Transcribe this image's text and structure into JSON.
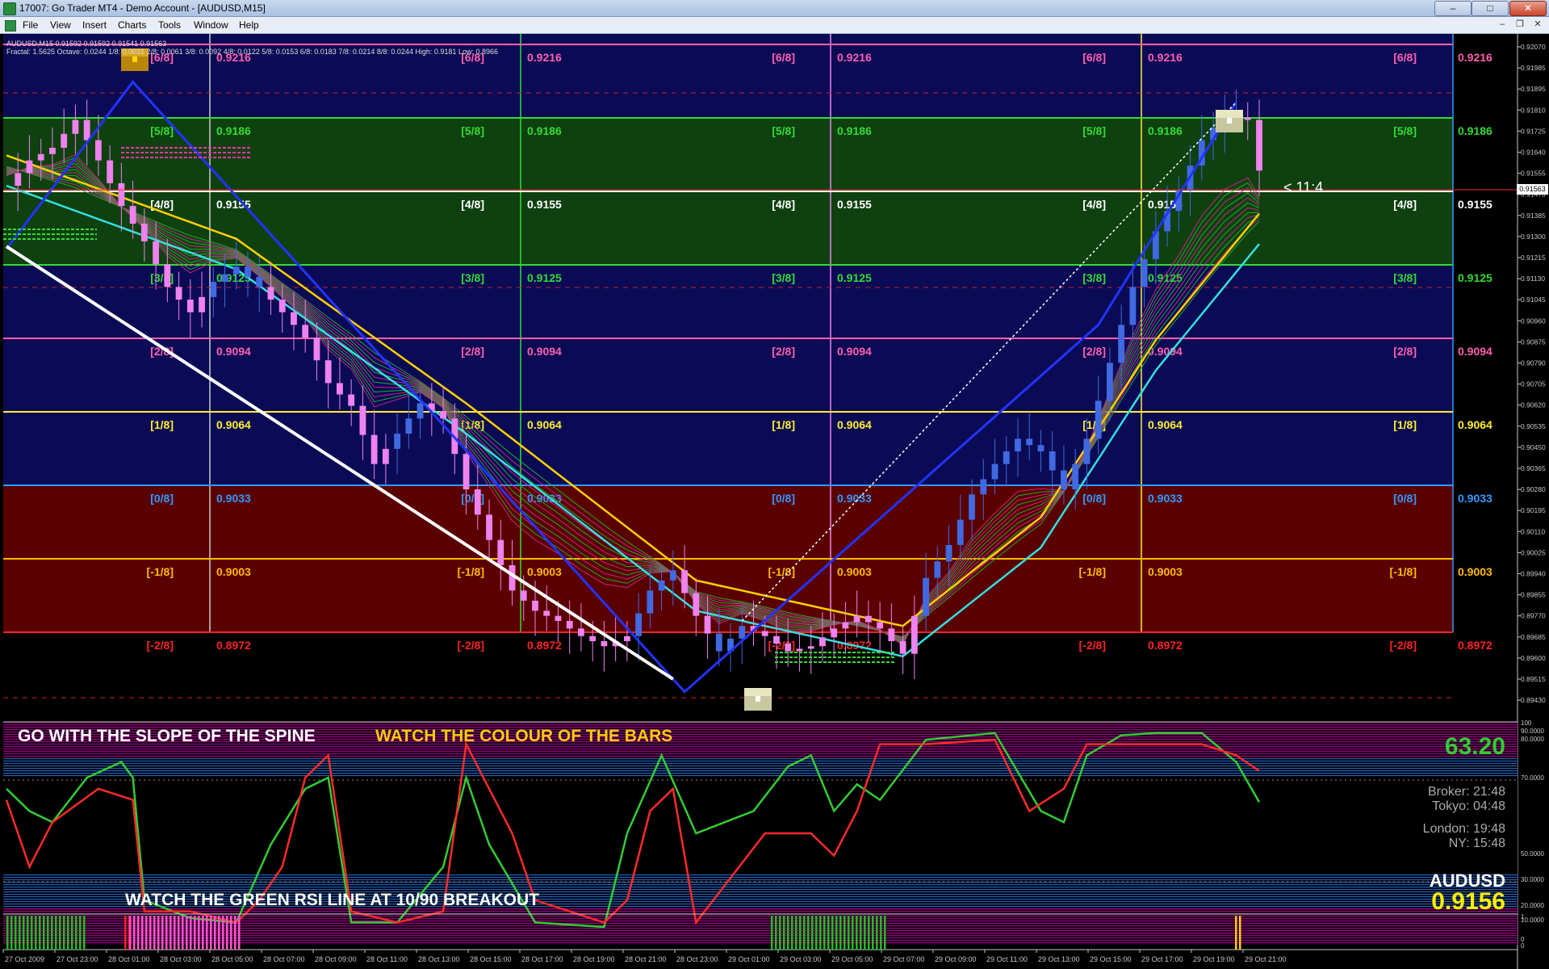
{
  "window": {
    "title": "17007: Go Trader MT4 - Demo Account - [AUDUSD,M15]",
    "min_label": "–",
    "max_label": "□",
    "close_label": "✕",
    "mdi_min": "–",
    "mdi_restore": "❐",
    "mdi_close": "✕"
  },
  "menu": [
    "File",
    "View",
    "Insert",
    "Charts",
    "Tools",
    "Window",
    "Help"
  ],
  "chart_header": {
    "symbol_line": "AUDUSD,M15  0.91592 0.91592 0.91541 0.91563",
    "fractal_line": "Fractal: 1.5625    Octave: 0.0244    1/8: 0.0031  2/8: 0.0061  3/8: 0.0092  4/8: 0.0122  5/8: 0.0153  6/8: 0.0183  7/8: 0.0214  8/8: 0.0244  High: 0.9181  Low: 0.8966"
  },
  "colors": {
    "bull": "#4169e1",
    "bear": "#ee82ee",
    "zone_top": "#0b0b55",
    "zone_green": "#0f4010",
    "zone_red": "#5a0000"
  },
  "murrey": [
    {
      "label": "[6/8]",
      "price": "0.9216",
      "color": "#ff5fb0"
    },
    {
      "label": "[5/8]",
      "price": "0.9186",
      "color": "#33dd33"
    },
    {
      "label": "[4/8]",
      "price": "0.9155",
      "color": "#ffffff"
    },
    {
      "label": "[3/8]",
      "price": "0.9125",
      "color": "#33dd33"
    },
    {
      "label": "[2/8]",
      "price": "0.9094",
      "color": "#ff5fb0"
    },
    {
      "label": "[1/8]",
      "price": "0.9064",
      "color": "#ffee33"
    },
    {
      "label": "[0/8]",
      "price": "0.9033",
      "color": "#3399ff"
    },
    {
      "label": "[-1/8]",
      "price": "0.9003",
      "color": "#ffbb00"
    },
    {
      "label": "[-2/8]",
      "price": "0.8972",
      "color": "#ff2222"
    }
  ],
  "price_axis": [
    "0.92070",
    "0.91985",
    "0.91895",
    "0.91810",
    "0.91725",
    "0.91640",
    "0.91555",
    "0.91470",
    "0.91385",
    "0.91300",
    "0.91215",
    "0.91130",
    "0.91045",
    "0.90960",
    "0.90875",
    "0.90790",
    "0.90705",
    "0.90620",
    "0.90535",
    "0.90450",
    "0.90365",
    "0.90280",
    "0.90195",
    "0.90110",
    "0.90025",
    "0.89940",
    "0.89855",
    "0.89770",
    "0.89685",
    "0.89600",
    "0.89515",
    "0.89430"
  ],
  "current_price_tag": "0.91563",
  "annotation": "< 11:4",
  "rsi_panel": {
    "text_white": "GO WITH THE SLOPE OF THE SPINE",
    "text_yellow": "WATCH THE COLOUR OF THE BARS",
    "text_bottom": "WATCH THE GREEN RSI LINE AT 10/90 BREAKOUT",
    "rsi_value": "63.20",
    "broker_time": "Broker: 21:48",
    "tokyo_time": "Tokyo: 04:48",
    "london_time": "London: 19:48",
    "ny_time": "NY: 15:48",
    "symbol": "AUDUSD",
    "price": "0.9156",
    "levels": [
      "100",
      "90.0000",
      "80.0000",
      "70.0000",
      "50.0000",
      "30.0000",
      "20.0000",
      "10.0000",
      "0"
    ]
  },
  "bar_panel": {
    "levels": [
      "1",
      "0"
    ]
  },
  "time_axis": [
    "27 Oct 2009",
    "27 Oct 23:00",
    "28 Oct 01:00",
    "28 Oct 03:00",
    "28 Oct 05:00",
    "28 Oct 07:00",
    "28 Oct 09:00",
    "28 Oct 11:00",
    "28 Oct 13:00",
    "28 Oct 15:00",
    "28 Oct 17:00",
    "28 Oct 19:00",
    "28 Oct 21:00",
    "28 Oct 23:00",
    "29 Oct 01:00",
    "29 Oct 03:00",
    "29 Oct 05:00",
    "29 Oct 07:00",
    "29 Oct 09:00",
    "29 Oct 11:00",
    "29 Oct 13:00",
    "29 Oct 15:00",
    "29 Oct 17:00",
    "29 Oct 19:00",
    "29 Oct 21:00"
  ],
  "chart_data": [
    {
      "type": "candlestick",
      "title": "AUDUSD,M15",
      "ylim": [
        0.894,
        0.921
      ],
      "close_path": [
        [
          0,
          0.915
        ],
        [
          2,
          0.916
        ],
        [
          4,
          0.9165
        ],
        [
          6,
          0.9176
        ],
        [
          8,
          0.916
        ],
        [
          10,
          0.9142
        ],
        [
          12,
          0.9128
        ],
        [
          14,
          0.911
        ],
        [
          16,
          0.91
        ],
        [
          18,
          0.9112
        ],
        [
          20,
          0.9118
        ],
        [
          22,
          0.911
        ],
        [
          24,
          0.91
        ],
        [
          26,
          0.909
        ],
        [
          28,
          0.9072
        ],
        [
          30,
          0.9063
        ],
        [
          32,
          0.904
        ],
        [
          34,
          0.9052
        ],
        [
          36,
          0.9064
        ],
        [
          38,
          0.9058
        ],
        [
          40,
          0.903
        ],
        [
          42,
          0.901
        ],
        [
          44,
          0.899
        ],
        [
          46,
          0.8982
        ],
        [
          48,
          0.8978
        ],
        [
          50,
          0.8972
        ],
        [
          52,
          0.8968
        ],
        [
          54,
          0.8972
        ],
        [
          56,
          0.899
        ],
        [
          58,
          0.8998
        ],
        [
          60,
          0.898
        ],
        [
          62,
          0.8966
        ],
        [
          64,
          0.8976
        ],
        [
          66,
          0.8972
        ],
        [
          68,
          0.8966
        ],
        [
          70,
          0.8968
        ],
        [
          72,
          0.8975
        ],
        [
          74,
          0.898
        ],
        [
          76,
          0.8975
        ],
        [
          78,
          0.8965
        ],
        [
          80,
          0.8995
        ],
        [
          82,
          0.9008
        ],
        [
          84,
          0.9028
        ],
        [
          86,
          0.904
        ],
        [
          88,
          0.905
        ],
        [
          90,
          0.9045
        ],
        [
          92,
          0.903
        ],
        [
          94,
          0.905
        ],
        [
          96,
          0.908
        ],
        [
          98,
          0.911
        ],
        [
          100,
          0.9132
        ],
        [
          102,
          0.9148
        ],
        [
          104,
          0.9168
        ],
        [
          106,
          0.9178
        ],
        [
          108,
          0.9176
        ],
        [
          109,
          0.9156
        ]
      ],
      "up_segments": [
        [
          18,
          22
        ],
        [
          34,
          36
        ],
        [
          55,
          58
        ],
        [
          62,
          64
        ],
        [
          80,
          107
        ]
      ],
      "spine": [
        [
          0,
          0.9158
        ],
        [
          20,
          0.9125
        ],
        [
          40,
          0.906
        ],
        [
          60,
          0.899
        ],
        [
          78,
          0.8972
        ],
        [
          90,
          0.9015
        ],
        [
          100,
          0.9085
        ],
        [
          109,
          0.9135
        ]
      ],
      "zigzag_blue": [
        [
          0,
          0.9125
        ],
        [
          11,
          0.9191
        ],
        [
          59,
          0.895
        ],
        [
          95,
          0.9095
        ],
        [
          107,
          0.9183
        ]
      ],
      "white_trend": [
        [
          0,
          0.9126
        ],
        [
          58,
          0.8955
        ]
      ],
      "white_trend2": [
        [
          64,
          0.8978
        ],
        [
          107,
          0.9183
        ]
      ]
    },
    {
      "type": "line",
      "title": "RSI",
      "ylim": [
        0,
        100
      ],
      "series": [
        {
          "color": "#33cc33",
          "points": [
            [
              0,
              70
            ],
            [
              2,
              60
            ],
            [
              4,
              55
            ],
            [
              7,
              75
            ],
            [
              10,
              82
            ],
            [
              11,
              75
            ],
            [
              12,
              20
            ],
            [
              16,
              12
            ],
            [
              20,
              10
            ],
            [
              23,
              45
            ],
            [
              26,
              70
            ],
            [
              28,
              75
            ],
            [
              30,
              10
            ],
            [
              34,
              10
            ],
            [
              38,
              35
            ],
            [
              40,
              75
            ],
            [
              42,
              45
            ],
            [
              46,
              10
            ],
            [
              52,
              8
            ],
            [
              54,
              50
            ],
            [
              57,
              85
            ],
            [
              60,
              50
            ],
            [
              65,
              60
            ],
            [
              68,
              80
            ],
            [
              70,
              85
            ],
            [
              72,
              60
            ],
            [
              74,
              72
            ],
            [
              76,
              65
            ],
            [
              80,
              92
            ],
            [
              86,
              95
            ],
            [
              90,
              60
            ],
            [
              92,
              55
            ],
            [
              94,
              85
            ],
            [
              97,
              94
            ],
            [
              100,
              95
            ],
            [
              104,
              95
            ],
            [
              107,
              82
            ],
            [
              109,
              64
            ]
          ]
        },
        {
          "color": "#ff2a2a",
          "points": [
            [
              0,
              65
            ],
            [
              2,
              35
            ],
            [
              4,
              55
            ],
            [
              8,
              70
            ],
            [
              11,
              65
            ],
            [
              12,
              15
            ],
            [
              16,
              15
            ],
            [
              20,
              10
            ],
            [
              22,
              20
            ],
            [
              24,
              35
            ],
            [
              26,
              75
            ],
            [
              28,
              85
            ],
            [
              30,
              15
            ],
            [
              34,
              10
            ],
            [
              38,
              15
            ],
            [
              40,
              90
            ],
            [
              42,
              70
            ],
            [
              44,
              50
            ],
            [
              46,
              20
            ],
            [
              52,
              10
            ],
            [
              54,
              20
            ],
            [
              56,
              60
            ],
            [
              58,
              70
            ],
            [
              60,
              10
            ],
            [
              66,
              50
            ],
            [
              70,
              50
            ],
            [
              72,
              40
            ],
            [
              74,
              60
            ],
            [
              76,
              90
            ],
            [
              80,
              90
            ],
            [
              86,
              92
            ],
            [
              89,
              60
            ],
            [
              92,
              70
            ],
            [
              94,
              90
            ],
            [
              97,
              90
            ],
            [
              100,
              90
            ],
            [
              104,
              90
            ],
            [
              107,
              85
            ],
            [
              109,
              78
            ]
          ]
        }
      ]
    }
  ]
}
